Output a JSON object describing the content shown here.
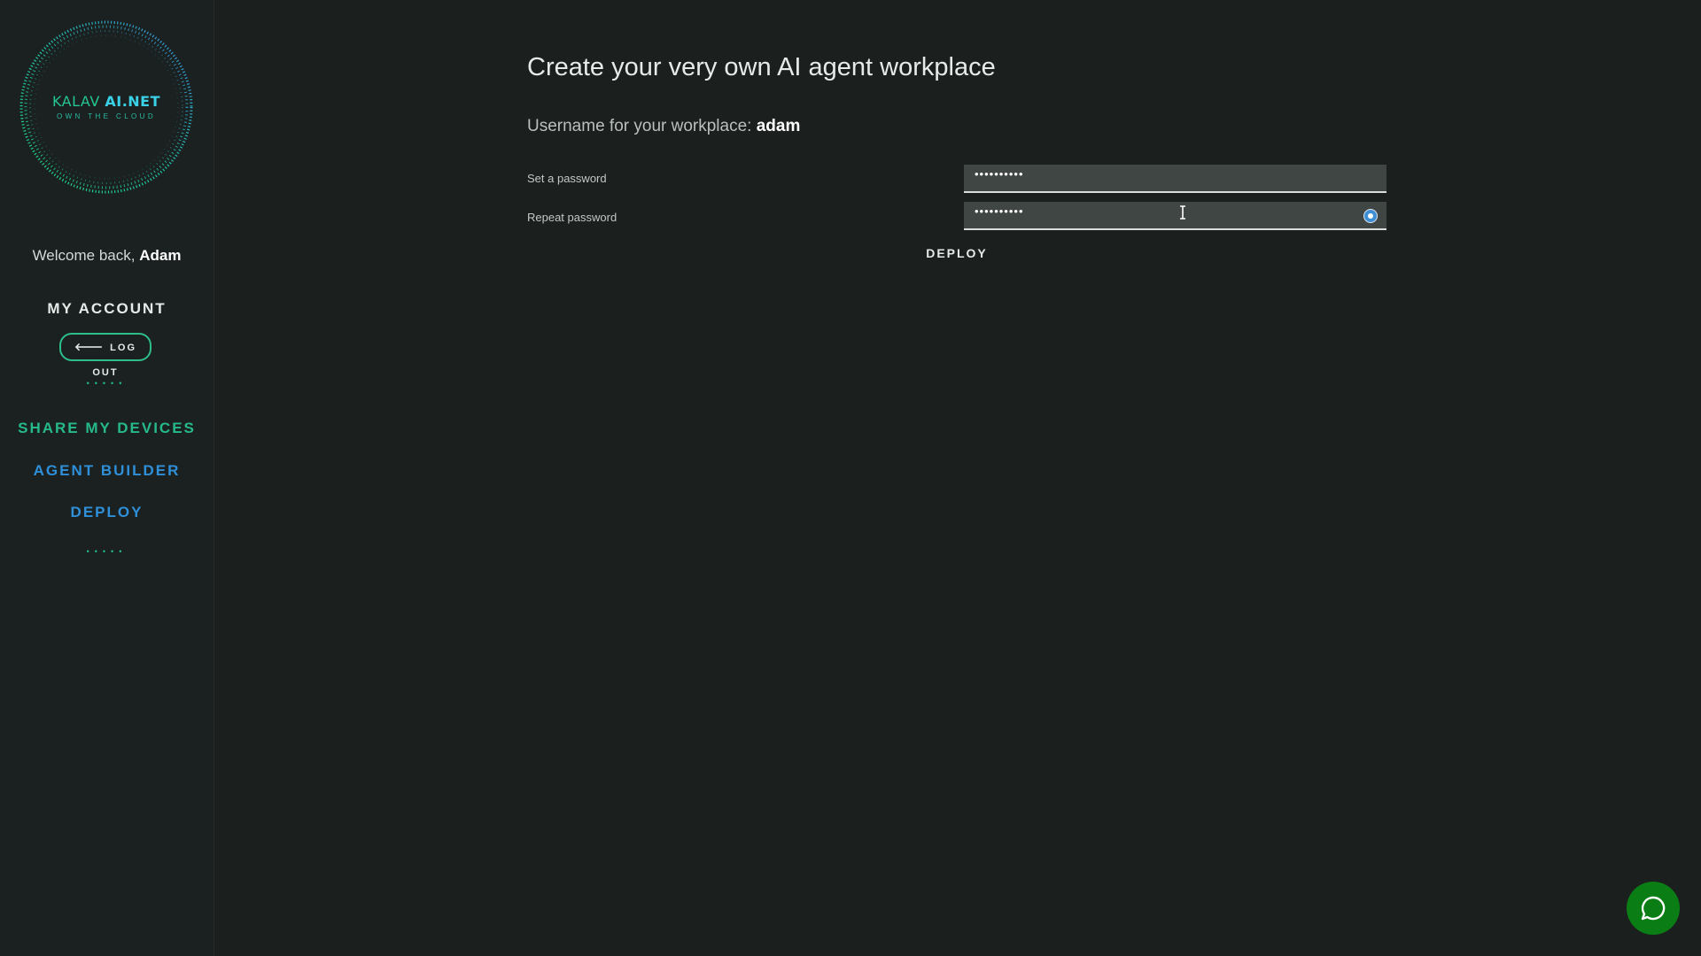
{
  "sidebar": {
    "logo": {
      "title_part1": "KALAV",
      "title_part2": "AI.NET",
      "tagline": "OWN THE CLOUD"
    },
    "welcome_prefix": "Welcome back,",
    "welcome_name": "Adam",
    "my_account_label": "MY ACCOUNT",
    "logout_label": "LOG OUT",
    "dots": "•••••",
    "items": [
      {
        "label": "SHARE MY DEVICES",
        "color": "#26b98a"
      },
      {
        "label": "AGENT BUILDER",
        "color": "#2f8fd8"
      },
      {
        "label": "DEPLOY",
        "color": "#2f8fd8"
      }
    ]
  },
  "main": {
    "title": "Create your very own AI agent workplace",
    "username_prefix": "Username for your workplace:",
    "username": "adam",
    "password_label": "Set a password",
    "password_value": "••••••••••",
    "repeat_label": "Repeat password",
    "repeat_value": "••••••••••",
    "deploy_label": "DEPLOY"
  },
  "colors": {
    "accent_green": "#2ebd8a",
    "accent_blue": "#2f8fd8",
    "chat_green": "#0a7d14"
  },
  "icons": [
    "logo-ring",
    "arrow-left-icon",
    "eye-toggle-icon",
    "text-cursor-icon",
    "chat-bubble-icon"
  ]
}
